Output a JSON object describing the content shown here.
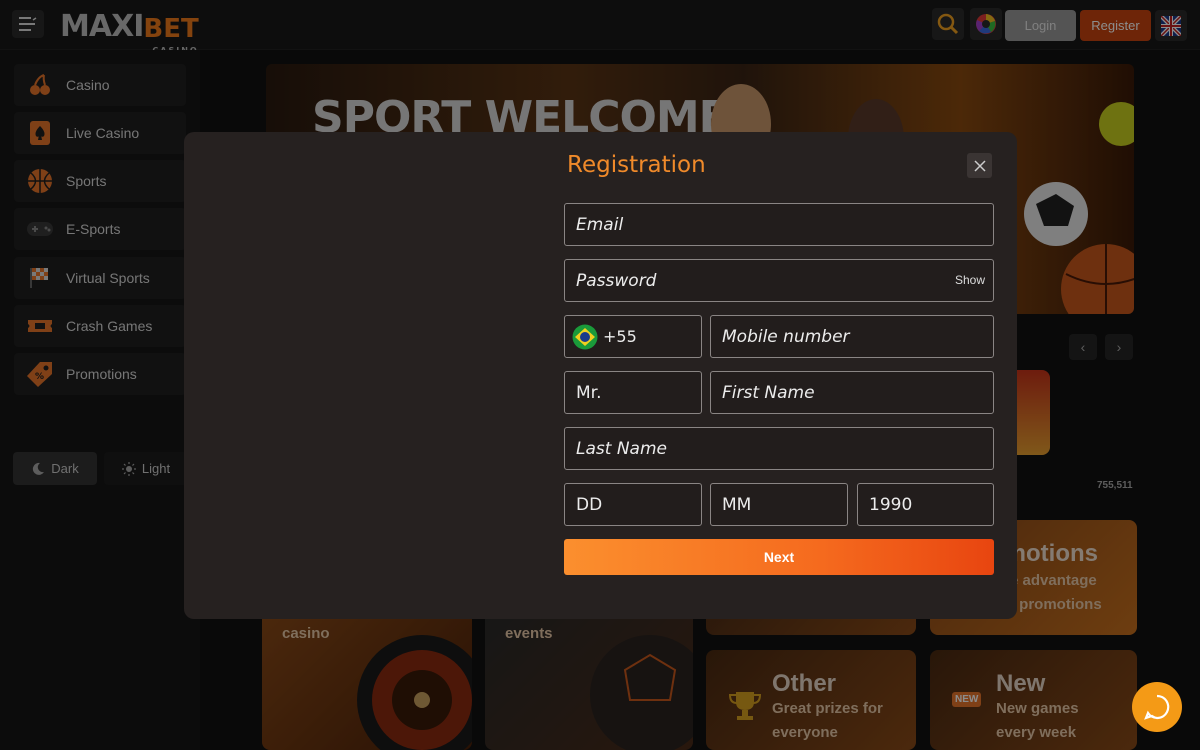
{
  "header": {
    "logo_main": "MAXI",
    "logo_accent": "BET",
    "logo_sub": "CASINO",
    "login_label": "Login",
    "register_label": "Register",
    "icons": [
      "menu-icon",
      "search-icon",
      "color-wheel-icon",
      "uk-flag-icon"
    ]
  },
  "sidebar": {
    "items": [
      {
        "label": "Casino",
        "icon": "cherries-icon"
      },
      {
        "label": "Live Casino",
        "icon": "card-spade-icon"
      },
      {
        "label": "Sports",
        "icon": "basketball-icon"
      },
      {
        "label": "E-Sports",
        "icon": "gamepad-icon"
      },
      {
        "label": "Virtual Sports",
        "icon": "checkered-flag-icon"
      },
      {
        "label": "Crash Games",
        "icon": "ticket-icon"
      },
      {
        "label": "Promotions",
        "icon": "tag-icon"
      }
    ],
    "theme": {
      "dark_label": "Dark",
      "light_label": "Light"
    }
  },
  "main": {
    "banner_title": "SPORT WELCOME",
    "jackpot_value": "755,511",
    "cards": [
      {
        "title": "",
        "subtitle": "casino"
      },
      {
        "title": "",
        "subtitle": "events"
      },
      {
        "title": "omotions",
        "line1": "e advantage",
        "line2": "ur promotions"
      },
      {
        "title": "Other",
        "line1": "Great prizes for",
        "line2": "everyone"
      },
      {
        "title": "New",
        "line1": "New games",
        "line2": "every week",
        "badge": "NEW"
      }
    ]
  },
  "modal": {
    "title": "Registration",
    "email_placeholder": "Email",
    "password_placeholder": "Password",
    "password_show": "Show",
    "phone_code": "+55",
    "mobile_placeholder": "Mobile number",
    "salutation": "Mr.",
    "first_name_placeholder": "First Name",
    "last_name_placeholder": "Last Name",
    "day_placeholder": "DD",
    "month_placeholder": "MM",
    "year_value": "1990",
    "next_label": "Next"
  },
  "colors": {
    "accent": "#f08a2a",
    "register": "#c8440f",
    "chat": "#f49a16"
  }
}
